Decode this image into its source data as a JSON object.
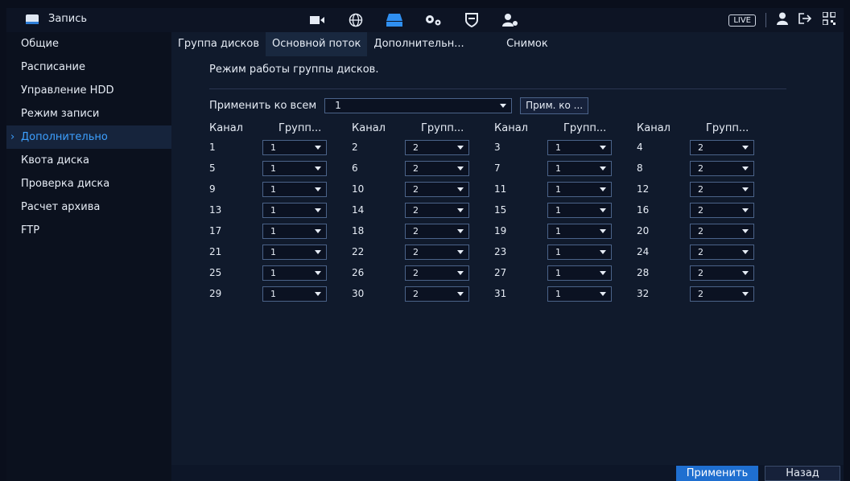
{
  "header": {
    "title": "Запись",
    "live_label": "LIVE",
    "nav_icons": [
      "camera-icon",
      "network-icon",
      "storage-icon",
      "system-icon",
      "security-icon",
      "account-icon"
    ]
  },
  "sidebar": {
    "items": [
      {
        "label": "Общие"
      },
      {
        "label": "Расписание"
      },
      {
        "label": "Управление HDD"
      },
      {
        "label": "Режим записи"
      },
      {
        "label": "Дополнительно",
        "active": true
      },
      {
        "label": "Квота диска"
      },
      {
        "label": "Проверка диска"
      },
      {
        "label": "Расчет архива"
      },
      {
        "label": "FTP"
      }
    ]
  },
  "tabs": [
    {
      "label": "Группа дисков"
    },
    {
      "label": "Основной поток",
      "active": true
    },
    {
      "label": "Дополнительн..."
    },
    {
      "label": "Снимок"
    }
  ],
  "content": {
    "title": "Режим работы группы дисков.",
    "apply_all_label": "Применить ко всем",
    "apply_all_value": "1",
    "apply_copy_btn": "Прим. ко ...",
    "col_channel": "Канал",
    "col_group": "Групп...",
    "rows": [
      [
        [
          "1",
          "1"
        ],
        [
          "2",
          "2"
        ],
        [
          "3",
          "1"
        ],
        [
          "4",
          "2"
        ]
      ],
      [
        [
          "5",
          "1"
        ],
        [
          "6",
          "2"
        ],
        [
          "7",
          "1"
        ],
        [
          "8",
          "2"
        ]
      ],
      [
        [
          "9",
          "1"
        ],
        [
          "10",
          "2"
        ],
        [
          "11",
          "1"
        ],
        [
          "12",
          "2"
        ]
      ],
      [
        [
          "13",
          "1"
        ],
        [
          "14",
          "2"
        ],
        [
          "15",
          "1"
        ],
        [
          "16",
          "2"
        ]
      ],
      [
        [
          "17",
          "1"
        ],
        [
          "18",
          "2"
        ],
        [
          "19",
          "1"
        ],
        [
          "20",
          "2"
        ]
      ],
      [
        [
          "21",
          "1"
        ],
        [
          "22",
          "2"
        ],
        [
          "23",
          "1"
        ],
        [
          "24",
          "2"
        ]
      ],
      [
        [
          "25",
          "1"
        ],
        [
          "26",
          "2"
        ],
        [
          "27",
          "1"
        ],
        [
          "28",
          "2"
        ]
      ],
      [
        [
          "29",
          "1"
        ],
        [
          "30",
          "2"
        ],
        [
          "31",
          "1"
        ],
        [
          "32",
          "2"
        ]
      ]
    ]
  },
  "footer": {
    "apply_label": "Применить",
    "back_label": "Назад"
  },
  "colors": {
    "accent": "#2f8ff0",
    "background": "#101a2c"
  }
}
